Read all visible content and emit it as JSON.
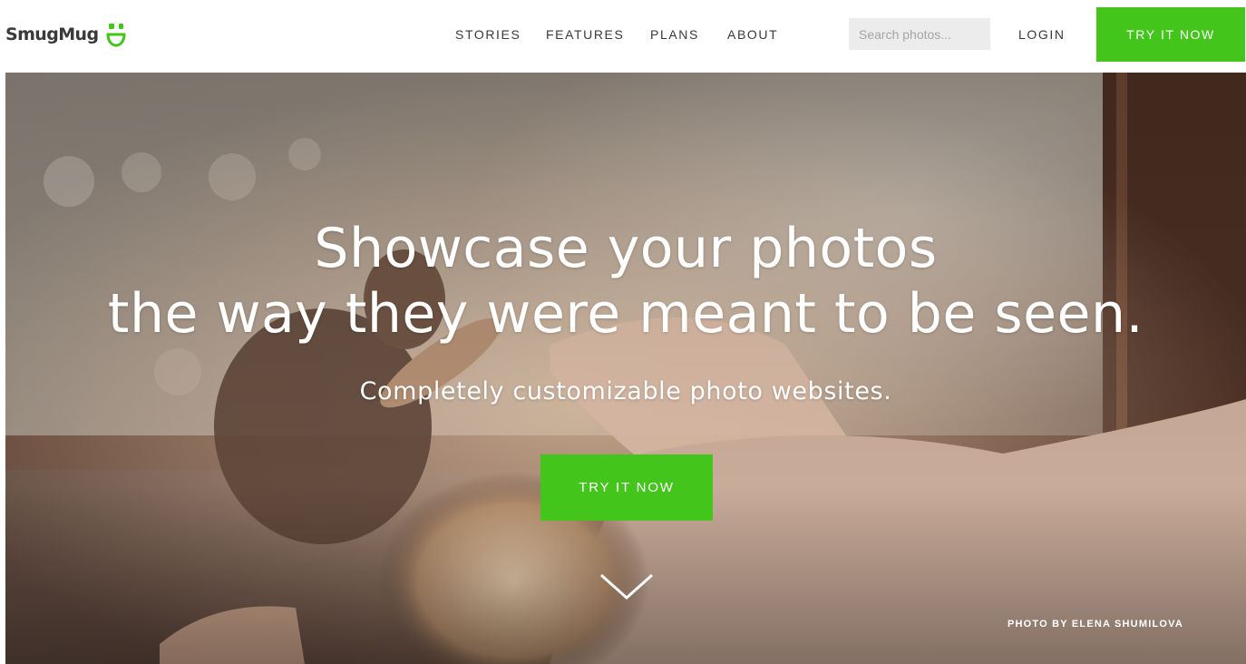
{
  "header": {
    "logo_text": "SmugMug",
    "logo_icon": "smiley-icon",
    "nav": {
      "stories": "STORIES",
      "features": "FEATURES",
      "plans": "PLANS",
      "about": "ABOUT"
    },
    "search": {
      "placeholder": "Search photos...",
      "value": ""
    },
    "login": "LOGIN",
    "cta": "TRY IT NOW"
  },
  "hero": {
    "title_line_1": "Showcase your photos",
    "title_line_2": "the way they were meant to be seen.",
    "subtitle": "Completely customizable photo websites.",
    "cta": "TRY IT NOW",
    "scroll_icon": "chevron-down-icon",
    "photo_credit": "PHOTO BY ELENA SHUMILOVA"
  },
  "colors": {
    "brand_green": "#44c51b",
    "nav_text": "#3a3a3a",
    "search_bg": "#ececec"
  }
}
